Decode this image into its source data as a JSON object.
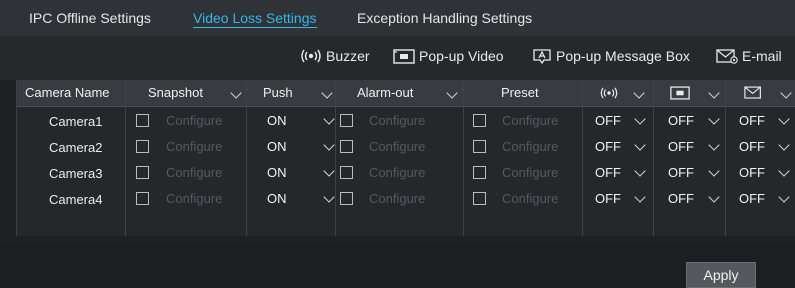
{
  "tabs": [
    {
      "label": "IPC Offline Settings",
      "active": false
    },
    {
      "label": "Video Loss Settings",
      "active": true
    },
    {
      "label": "Exception Handling Settings",
      "active": false
    }
  ],
  "toolbar": {
    "buzzer": {
      "label": "Buzzer",
      "icon": "buzzer-icon"
    },
    "popup_video": {
      "label": "Pop-up Video",
      "icon": "popup-video-icon"
    },
    "popup_message": {
      "label": "Pop-up Message Box",
      "icon": "popup-message-icon"
    },
    "email": {
      "label": "E-mail",
      "icon": "email-icon"
    }
  },
  "table": {
    "headers": {
      "camera_name": "Camera Name",
      "snapshot": "Snapshot",
      "push": "Push",
      "alarm_out": "Alarm-out",
      "preset": "Preset",
      "buzzer_icon": "buzzer-icon",
      "video_icon": "popup-video-icon",
      "email_icon": "email-icon"
    },
    "configure_label": "Configure",
    "rows": [
      {
        "name": "Camera1",
        "push": "ON",
        "buzzer": "OFF",
        "video": "OFF",
        "email": "OFF"
      },
      {
        "name": "Camera2",
        "push": "ON",
        "buzzer": "OFF",
        "video": "OFF",
        "email": "OFF"
      },
      {
        "name": "Camera3",
        "push": "ON",
        "buzzer": "OFF",
        "video": "OFF",
        "email": "OFF"
      },
      {
        "name": "Camera4",
        "push": "ON",
        "buzzer": "OFF",
        "video": "OFF",
        "email": "OFF"
      }
    ]
  },
  "footer": {
    "apply_label": "Apply"
  },
  "colors": {
    "accent": "#35b7e8",
    "background": "#1e2124",
    "header": "#383c40"
  }
}
